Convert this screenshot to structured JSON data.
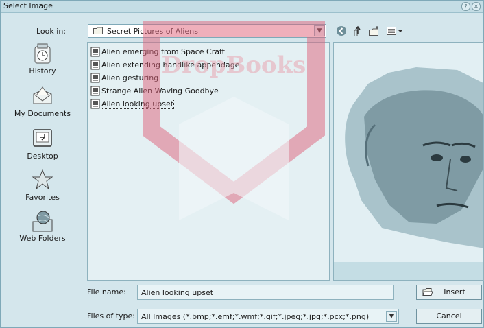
{
  "window": {
    "title": "Select Image"
  },
  "look_in": {
    "label": "Look in:",
    "value": "Secret Pictures of Aliens"
  },
  "toolbar": {
    "back_icon": "back-arrow-icon",
    "up_icon": "up-folder-icon",
    "new_folder_icon": "new-folder-icon",
    "views_icon": "views-menu-icon"
  },
  "places": [
    {
      "label": "History",
      "icon": "history-icon"
    },
    {
      "label": "My Documents",
      "icon": "my-documents-icon"
    },
    {
      "label": "Desktop",
      "icon": "desktop-icon"
    },
    {
      "label": "Favorites",
      "icon": "favorites-star-icon"
    },
    {
      "label": "Web Folders",
      "icon": "web-folders-icon"
    }
  ],
  "files": [
    {
      "name": "Alien emerging from Space Craft",
      "selected": false
    },
    {
      "name": "Alien extending handlike appendage",
      "selected": false
    },
    {
      "name": "Alien gesturing",
      "selected": false
    },
    {
      "name": "Strange Alien Waving Goodbye",
      "selected": false
    },
    {
      "name": "Alien looking upset",
      "selected": true
    }
  ],
  "file_name": {
    "label": "File name:",
    "value": "Alien looking upset"
  },
  "file_type": {
    "label": "Files of type:",
    "value": "All Images (*.bmp;*.emf;*.wmf;*.gif;*.jpeg;*.jpg;*.pcx;*.png)"
  },
  "buttons": {
    "insert": "Insert",
    "cancel": "Cancel"
  },
  "watermark": {
    "text": "DropBooks"
  },
  "colors": {
    "accent": "#7fa9b8",
    "background": "#d4e6ec",
    "watermark": "#e0627a"
  }
}
